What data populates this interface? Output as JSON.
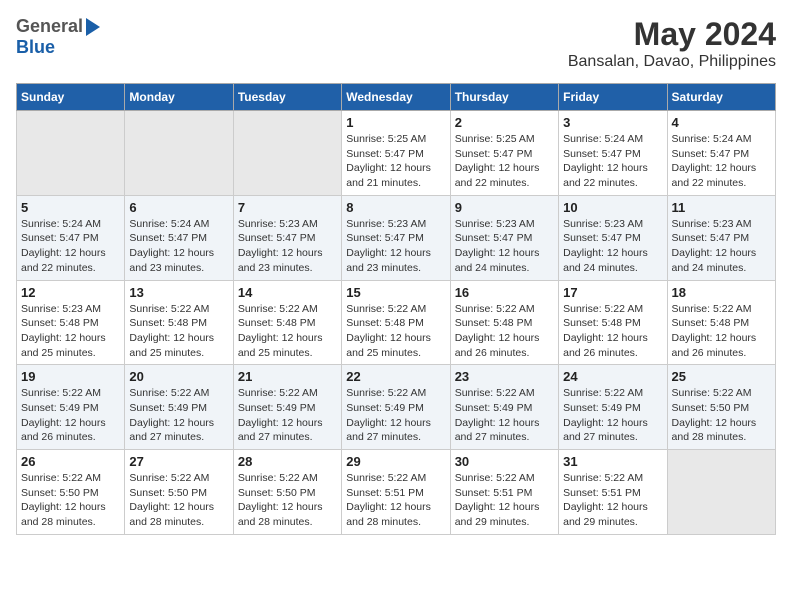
{
  "header": {
    "logo_general": "General",
    "logo_blue": "Blue",
    "month_year": "May 2024",
    "location": "Bansalan, Davao, Philippines"
  },
  "weekdays": [
    "Sunday",
    "Monday",
    "Tuesday",
    "Wednesday",
    "Thursday",
    "Friday",
    "Saturday"
  ],
  "weeks": [
    [
      {
        "day": "",
        "sunrise": "",
        "sunset": "",
        "daylight": ""
      },
      {
        "day": "",
        "sunrise": "",
        "sunset": "",
        "daylight": ""
      },
      {
        "day": "",
        "sunrise": "",
        "sunset": "",
        "daylight": ""
      },
      {
        "day": "1",
        "sunrise": "Sunrise: 5:25 AM",
        "sunset": "Sunset: 5:47 PM",
        "daylight": "Daylight: 12 hours and 21 minutes."
      },
      {
        "day": "2",
        "sunrise": "Sunrise: 5:25 AM",
        "sunset": "Sunset: 5:47 PM",
        "daylight": "Daylight: 12 hours and 22 minutes."
      },
      {
        "day": "3",
        "sunrise": "Sunrise: 5:24 AM",
        "sunset": "Sunset: 5:47 PM",
        "daylight": "Daylight: 12 hours and 22 minutes."
      },
      {
        "day": "4",
        "sunrise": "Sunrise: 5:24 AM",
        "sunset": "Sunset: 5:47 PM",
        "daylight": "Daylight: 12 hours and 22 minutes."
      }
    ],
    [
      {
        "day": "5",
        "sunrise": "Sunrise: 5:24 AM",
        "sunset": "Sunset: 5:47 PM",
        "daylight": "Daylight: 12 hours and 22 minutes."
      },
      {
        "day": "6",
        "sunrise": "Sunrise: 5:24 AM",
        "sunset": "Sunset: 5:47 PM",
        "daylight": "Daylight: 12 hours and 23 minutes."
      },
      {
        "day": "7",
        "sunrise": "Sunrise: 5:23 AM",
        "sunset": "Sunset: 5:47 PM",
        "daylight": "Daylight: 12 hours and 23 minutes."
      },
      {
        "day": "8",
        "sunrise": "Sunrise: 5:23 AM",
        "sunset": "Sunset: 5:47 PM",
        "daylight": "Daylight: 12 hours and 23 minutes."
      },
      {
        "day": "9",
        "sunrise": "Sunrise: 5:23 AM",
        "sunset": "Sunset: 5:47 PM",
        "daylight": "Daylight: 12 hours and 24 minutes."
      },
      {
        "day": "10",
        "sunrise": "Sunrise: 5:23 AM",
        "sunset": "Sunset: 5:47 PM",
        "daylight": "Daylight: 12 hours and 24 minutes."
      },
      {
        "day": "11",
        "sunrise": "Sunrise: 5:23 AM",
        "sunset": "Sunset: 5:47 PM",
        "daylight": "Daylight: 12 hours and 24 minutes."
      }
    ],
    [
      {
        "day": "12",
        "sunrise": "Sunrise: 5:23 AM",
        "sunset": "Sunset: 5:48 PM",
        "daylight": "Daylight: 12 hours and 25 minutes."
      },
      {
        "day": "13",
        "sunrise": "Sunrise: 5:22 AM",
        "sunset": "Sunset: 5:48 PM",
        "daylight": "Daylight: 12 hours and 25 minutes."
      },
      {
        "day": "14",
        "sunrise": "Sunrise: 5:22 AM",
        "sunset": "Sunset: 5:48 PM",
        "daylight": "Daylight: 12 hours and 25 minutes."
      },
      {
        "day": "15",
        "sunrise": "Sunrise: 5:22 AM",
        "sunset": "Sunset: 5:48 PM",
        "daylight": "Daylight: 12 hours and 25 minutes."
      },
      {
        "day": "16",
        "sunrise": "Sunrise: 5:22 AM",
        "sunset": "Sunset: 5:48 PM",
        "daylight": "Daylight: 12 hours and 26 minutes."
      },
      {
        "day": "17",
        "sunrise": "Sunrise: 5:22 AM",
        "sunset": "Sunset: 5:48 PM",
        "daylight": "Daylight: 12 hours and 26 minutes."
      },
      {
        "day": "18",
        "sunrise": "Sunrise: 5:22 AM",
        "sunset": "Sunset: 5:48 PM",
        "daylight": "Daylight: 12 hours and 26 minutes."
      }
    ],
    [
      {
        "day": "19",
        "sunrise": "Sunrise: 5:22 AM",
        "sunset": "Sunset: 5:49 PM",
        "daylight": "Daylight: 12 hours and 26 minutes."
      },
      {
        "day": "20",
        "sunrise": "Sunrise: 5:22 AM",
        "sunset": "Sunset: 5:49 PM",
        "daylight": "Daylight: 12 hours and 27 minutes."
      },
      {
        "day": "21",
        "sunrise": "Sunrise: 5:22 AM",
        "sunset": "Sunset: 5:49 PM",
        "daylight": "Daylight: 12 hours and 27 minutes."
      },
      {
        "day": "22",
        "sunrise": "Sunrise: 5:22 AM",
        "sunset": "Sunset: 5:49 PM",
        "daylight": "Daylight: 12 hours and 27 minutes."
      },
      {
        "day": "23",
        "sunrise": "Sunrise: 5:22 AM",
        "sunset": "Sunset: 5:49 PM",
        "daylight": "Daylight: 12 hours and 27 minutes."
      },
      {
        "day": "24",
        "sunrise": "Sunrise: 5:22 AM",
        "sunset": "Sunset: 5:49 PM",
        "daylight": "Daylight: 12 hours and 27 minutes."
      },
      {
        "day": "25",
        "sunrise": "Sunrise: 5:22 AM",
        "sunset": "Sunset: 5:50 PM",
        "daylight": "Daylight: 12 hours and 28 minutes."
      }
    ],
    [
      {
        "day": "26",
        "sunrise": "Sunrise: 5:22 AM",
        "sunset": "Sunset: 5:50 PM",
        "daylight": "Daylight: 12 hours and 28 minutes."
      },
      {
        "day": "27",
        "sunrise": "Sunrise: 5:22 AM",
        "sunset": "Sunset: 5:50 PM",
        "daylight": "Daylight: 12 hours and 28 minutes."
      },
      {
        "day": "28",
        "sunrise": "Sunrise: 5:22 AM",
        "sunset": "Sunset: 5:50 PM",
        "daylight": "Daylight: 12 hours and 28 minutes."
      },
      {
        "day": "29",
        "sunrise": "Sunrise: 5:22 AM",
        "sunset": "Sunset: 5:51 PM",
        "daylight": "Daylight: 12 hours and 28 minutes."
      },
      {
        "day": "30",
        "sunrise": "Sunrise: 5:22 AM",
        "sunset": "Sunset: 5:51 PM",
        "daylight": "Daylight: 12 hours and 29 minutes."
      },
      {
        "day": "31",
        "sunrise": "Sunrise: 5:22 AM",
        "sunset": "Sunset: 5:51 PM",
        "daylight": "Daylight: 12 hours and 29 minutes."
      },
      {
        "day": "",
        "sunrise": "",
        "sunset": "",
        "daylight": ""
      }
    ]
  ]
}
